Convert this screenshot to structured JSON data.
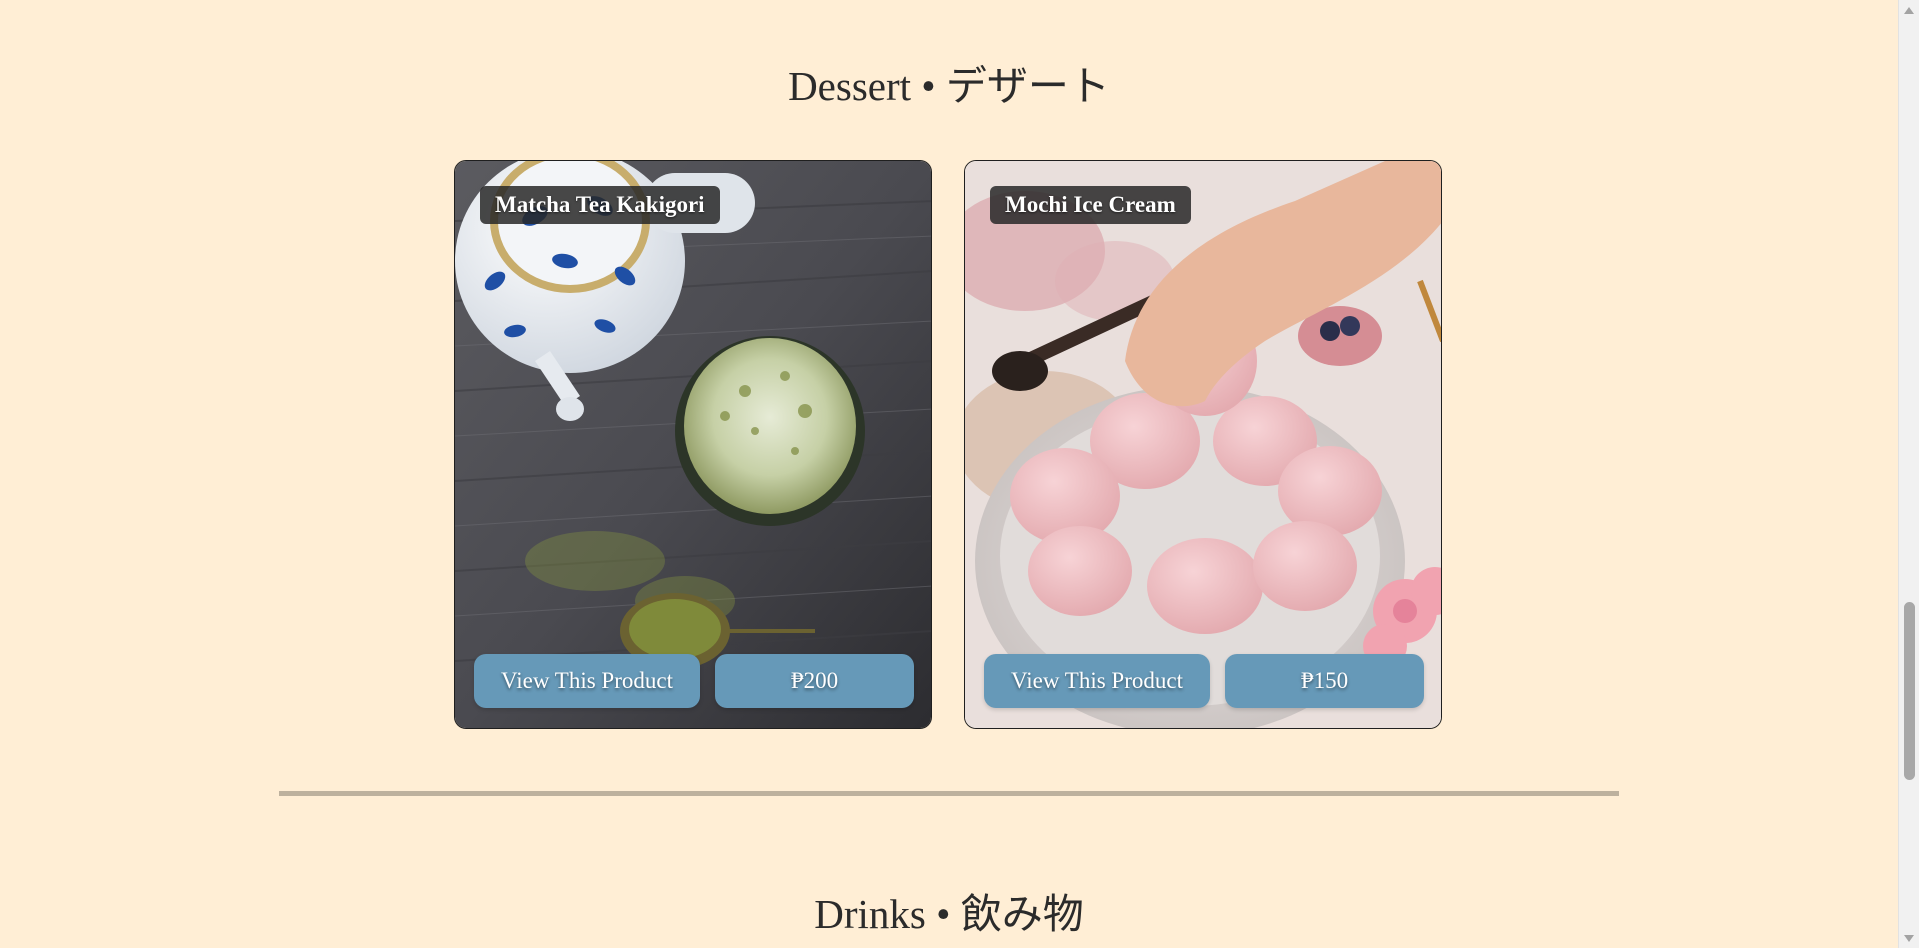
{
  "sections": {
    "dessert_title": "Dessert • デザート",
    "drinks_title": "Drinks • 飲み物"
  },
  "products": [
    {
      "name": "Matcha Tea Kakigori",
      "view_label": "View This Product",
      "price": "₱200",
      "image_icon": "matcha-kakigori-photo"
    },
    {
      "name": "Mochi Ice Cream",
      "view_label": "View This Product",
      "price": "₱150",
      "image_icon": "mochi-ice-cream-photo"
    }
  ],
  "colors": {
    "background": "#ffeed5",
    "button": "#6699b8",
    "divider": "#bdb19e",
    "name_badge": "#282828"
  }
}
